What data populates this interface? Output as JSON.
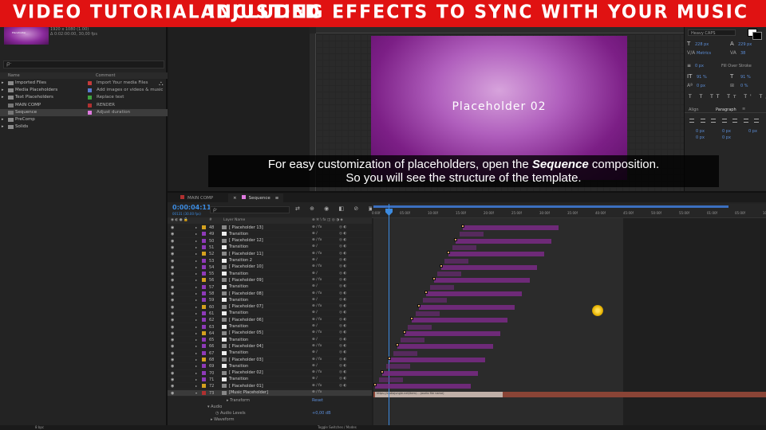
{
  "banner": {
    "left": "VIDEO TUTORIAL INCLUDED",
    "right": "ADJUSTING EFFECTS TO SYNC WITH YOUR MUSIC"
  },
  "project": {
    "info": [
      "1920 x 1080 (1.00)",
      "Δ 0:02:00:00, 30,00 fps"
    ],
    "search_placeholder": "ρ·",
    "col_name": "Name",
    "col_comment": "Comment",
    "items": [
      {
        "name": "Imported Files",
        "comment": "Import Your media Files",
        "color": "#c33b3b"
      },
      {
        "name": "Media Placeholders",
        "comment": "Add images or videos & music",
        "color": "#5a7ad0"
      },
      {
        "name": "Text Placeholders",
        "comment": "Replace text",
        "color": "#3fa33f"
      },
      {
        "name": "MAIN COMP",
        "comment": "RENDER",
        "color": "#b03030"
      },
      {
        "name": "Sequence",
        "comment": "Adjust duration",
        "color": "#e07ae0"
      },
      {
        "name": "PreComp",
        "comment": "",
        "color": ""
      },
      {
        "name": "Solids",
        "comment": "",
        "color": ""
      }
    ]
  },
  "viewer": {
    "placeholder_text": "Placeholder 02"
  },
  "character": {
    "font_style": "Heavy CAPS",
    "size": "228 px",
    "leading": "229 px",
    "kerning": "Metrics",
    "tracking": "38",
    "stroke": "0 px",
    "stroke_mode": "Fill Over Stroke",
    "vscale": "91 %",
    "hscale": "91 %",
    "baseline": "0 px",
    "tsume": "0 %",
    "tab_align": "Align",
    "tab_paragraph": "Paragraph"
  },
  "subtitle": {
    "line1_pre": "For easy customization of placeholders, open the ",
    "line1_em": "Sequence",
    "line1_post": " composition.",
    "line2": "So you will see the structure of the template."
  },
  "timeline": {
    "tabs": [
      {
        "label": "MAIN COMP",
        "color": "#b03030"
      },
      {
        "label": "Sequence",
        "color": "#e07ae0"
      }
    ],
    "timecode": "0:00:04:11",
    "timecode_sub": "00131 (30.00 fps)",
    "search_placeholder": "ρ·",
    "col_layer_name": "Layer Name",
    "ruler": [
      "0:00f",
      "05:00f",
      "10:00f",
      "15:00f",
      "20:00f",
      "25:00f",
      "30:00f",
      "35:00f",
      "40:00f",
      "45:00f",
      "50:00f",
      "55:00f",
      "01:00f",
      "05:00f",
      "10:00f",
      "15:00f"
    ],
    "layers": [
      {
        "num": "48",
        "name": "[ Placeholder 13]",
        "type": "ph"
      },
      {
        "num": "49",
        "name": "Transition",
        "type": "tr"
      },
      {
        "num": "50",
        "name": "[ Placeholder 12]",
        "type": "ph"
      },
      {
        "num": "51",
        "name": "Transition",
        "type": "tr"
      },
      {
        "num": "52",
        "name": "[ Placeholder 11]",
        "type": "ph"
      },
      {
        "num": "53",
        "name": "Transition 2",
        "type": "tr"
      },
      {
        "num": "54",
        "name": "[ Placeholder 10]",
        "type": "ph"
      },
      {
        "num": "55",
        "name": "Transition",
        "type": "tr"
      },
      {
        "num": "56",
        "name": "[ Placeholder 09]",
        "type": "ph"
      },
      {
        "num": "57",
        "name": "Transition",
        "type": "tr"
      },
      {
        "num": "58",
        "name": "[ Placeholder 08]",
        "type": "ph"
      },
      {
        "num": "59",
        "name": "Transition",
        "type": "tr"
      },
      {
        "num": "60",
        "name": "[ Placeholder 07]",
        "type": "ph"
      },
      {
        "num": "61",
        "name": "Transition",
        "type": "tr"
      },
      {
        "num": "62",
        "name": "[ Placeholder 06]",
        "type": "ph"
      },
      {
        "num": "63",
        "name": "Transition",
        "type": "tr"
      },
      {
        "num": "64",
        "name": "[ Placeholder 05]",
        "type": "ph"
      },
      {
        "num": "65",
        "name": "Transition",
        "type": "tr"
      },
      {
        "num": "66",
        "name": "[ Placeholder 04]",
        "type": "ph"
      },
      {
        "num": "67",
        "name": "Transition",
        "type": "tr"
      },
      {
        "num": "68",
        "name": "[ Placeholder 03]",
        "type": "ph"
      },
      {
        "num": "69",
        "name": "Transition",
        "type": "tr"
      },
      {
        "num": "70",
        "name": "[ Placeholder 02]",
        "type": "ph"
      },
      {
        "num": "71",
        "name": "Transition",
        "type": "tr"
      },
      {
        "num": "72",
        "name": "[ Placeholder 01]",
        "type": "ph"
      },
      {
        "num": "73",
        "name": "[Music Placeholder]",
        "type": "mu"
      }
    ],
    "props": {
      "transform": "Transform",
      "reset": "Reset",
      "audio": "Audio",
      "levels": "Audio Levels",
      "levels_val": "+0,00 dB",
      "waveform": "Waveform"
    },
    "audio_clip_label": "https://audiojungle.net/item/....(audio file name)",
    "toggle": "Toggle Switches / Modes",
    "bpc": "8 bpc"
  }
}
